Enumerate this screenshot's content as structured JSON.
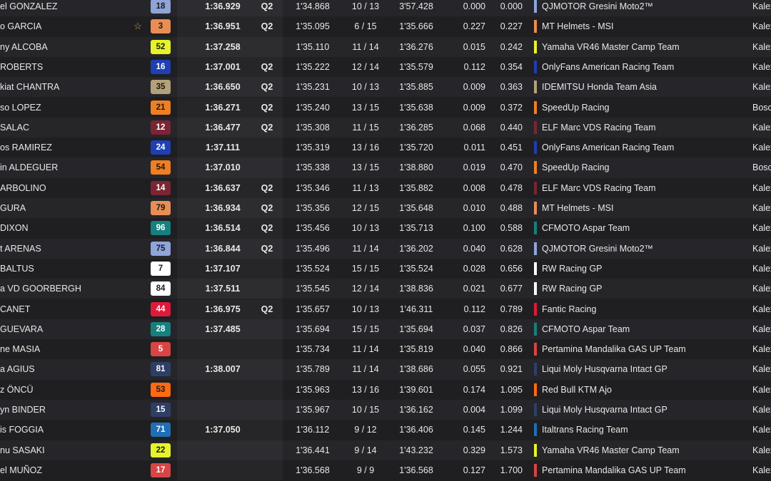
{
  "riders": [
    {
      "name": "el GONZALEZ",
      "fav": false,
      "number": "18",
      "num_bg": "#8fa4d9",
      "num_fg": "#1a1a1a",
      "best": "1:36.929",
      "q": "Q2",
      "lap": "1'34.868",
      "laps": "10 / 13",
      "ref": "3'57.428",
      "gap1": "0.000",
      "gap2": "0.000",
      "team": "QJMOTOR Gresini Moto2™",
      "team_color": "#8fa4d9",
      "manufacturer": "Kalex"
    },
    {
      "name": "o GARCIA",
      "fav": true,
      "number": "3",
      "num_bg": "#e98d55",
      "num_fg": "#1a1a1a",
      "best": "1:36.951",
      "q": "Q2",
      "lap": "1'35.095",
      "laps": "6 / 15",
      "ref": "1'35.666",
      "gap1": "0.227",
      "gap2": "0.227",
      "team": "MT Helmets - MSI",
      "team_color": "#e98d55",
      "manufacturer": "Kalex"
    },
    {
      "name": "ny ALCOBA",
      "fav": false,
      "number": "52",
      "num_bg": "#e6f32a",
      "num_fg": "#1a1a1a",
      "best": "1:37.258",
      "q": "",
      "lap": "1'35.110",
      "laps": "11 / 14",
      "ref": "1'36.276",
      "gap1": "0.015",
      "gap2": "0.242",
      "team": "Yamaha VR46 Master Camp Team",
      "team_color": "#e6f32a",
      "manufacturer": "Kalex"
    },
    {
      "name": "ROBERTS",
      "fav": false,
      "number": "16",
      "num_bg": "#1f3fb3",
      "num_fg": "#ffffff",
      "best": "1:37.001",
      "q": "Q2",
      "lap": "1'35.222",
      "laps": "12 / 14",
      "ref": "1'35.579",
      "gap1": "0.112",
      "gap2": "0.354",
      "team": "OnlyFans American Racing Team",
      "team_color": "#1f3fb3",
      "manufacturer": "Kalex"
    },
    {
      "name": "kiat CHANTRA",
      "fav": false,
      "number": "35",
      "num_bg": "#b3a17a",
      "num_fg": "#1a1a1a",
      "best": "1:36.650",
      "q": "Q2",
      "lap": "1'35.231",
      "laps": "10 / 13",
      "ref": "1'35.885",
      "gap1": "0.009",
      "gap2": "0.363",
      "team": "IDEMITSU Honda Team Asia",
      "team_color": "#b3a17a",
      "manufacturer": "Kalex"
    },
    {
      "name": "so LOPEZ",
      "fav": false,
      "number": "21",
      "num_bg": "#ef7f22",
      "num_fg": "#1a1a1a",
      "best": "1:36.271",
      "q": "Q2",
      "lap": "1'35.240",
      "laps": "13 / 15",
      "ref": "1'35.638",
      "gap1": "0.009",
      "gap2": "0.372",
      "team": "SpeedUp Racing",
      "team_color": "#ef7f22",
      "manufacturer": "Bosc"
    },
    {
      "name": "SALAC",
      "fav": false,
      "number": "12",
      "num_bg": "#7b2534",
      "num_fg": "#ffffff",
      "best": "1:36.477",
      "q": "Q2",
      "lap": "1'35.308",
      "laps": "11 / 15",
      "ref": "1'36.285",
      "gap1": "0.068",
      "gap2": "0.440",
      "team": "ELF Marc VDS Racing Team",
      "team_color": "#7b2534",
      "manufacturer": "Kalex"
    },
    {
      "name": "os RAMIREZ",
      "fav": false,
      "number": "24",
      "num_bg": "#1f3fb3",
      "num_fg": "#ffffff",
      "best": "1:37.111",
      "q": "",
      "lap": "1'35.319",
      "laps": "13 / 16",
      "ref": "1'35.720",
      "gap1": "0.011",
      "gap2": "0.451",
      "team": "OnlyFans American Racing Team",
      "team_color": "#1f3fb3",
      "manufacturer": "Kalex"
    },
    {
      "name": "in ALDEGUER",
      "fav": false,
      "number": "54",
      "num_bg": "#ef7f22",
      "num_fg": "#1a1a1a",
      "best": "1:37.010",
      "q": "",
      "lap": "1'35.338",
      "laps": "13 / 15",
      "ref": "1'38.880",
      "gap1": "0.019",
      "gap2": "0.470",
      "team": "SpeedUp Racing",
      "team_color": "#ef7f22",
      "manufacturer": "Bosc"
    },
    {
      "name": "ARBOLINO",
      "fav": false,
      "number": "14",
      "num_bg": "#7b2534",
      "num_fg": "#ffffff",
      "best": "1:36.637",
      "q": "Q2",
      "lap": "1'35.346",
      "laps": "11 / 13",
      "ref": "1'35.882",
      "gap1": "0.008",
      "gap2": "0.478",
      "team": "ELF Marc VDS Racing Team",
      "team_color": "#7b2534",
      "manufacturer": "Kalex"
    },
    {
      "name": "GURA",
      "fav": false,
      "number": "79",
      "num_bg": "#e98d55",
      "num_fg": "#1a1a1a",
      "best": "1:36.934",
      "q": "Q2",
      "lap": "1'35.356",
      "laps": "12 / 15",
      "ref": "1'35.648",
      "gap1": "0.010",
      "gap2": "0.488",
      "team": "MT Helmets - MSI",
      "team_color": "#e98d55",
      "manufacturer": "Kalex"
    },
    {
      "name": "DIXON",
      "fav": false,
      "number": "96",
      "num_bg": "#16807f",
      "num_fg": "#ffffff",
      "best": "1:36.514",
      "q": "Q2",
      "lap": "1'35.456",
      "laps": "10 / 13",
      "ref": "1'35.713",
      "gap1": "0.100",
      "gap2": "0.588",
      "team": "CFMOTO Aspar Team",
      "team_color": "#16807f",
      "manufacturer": "Kalex"
    },
    {
      "name": "t ARENAS",
      "fav": false,
      "number": "75",
      "num_bg": "#8fa4d9",
      "num_fg": "#1a1a1a",
      "best": "1:36.844",
      "q": "Q2",
      "lap": "1'35.496",
      "laps": "11 / 14",
      "ref": "1'36.202",
      "gap1": "0.040",
      "gap2": "0.628",
      "team": "QJMOTOR Gresini Moto2™",
      "team_color": "#8fa4d9",
      "manufacturer": "Kalex"
    },
    {
      "name": "BALTUS",
      "fav": false,
      "number": "7",
      "num_bg": "#ffffff",
      "num_fg": "#1a1a1a",
      "best": "1:37.107",
      "q": "",
      "lap": "1'35.524",
      "laps": "15 / 15",
      "ref": "1'35.524",
      "gap1": "0.028",
      "gap2": "0.656",
      "team": "RW Racing GP",
      "team_color": "#ffffff",
      "manufacturer": "Kalex"
    },
    {
      "name": "a VD GOORBERGH",
      "fav": false,
      "number": "84",
      "num_bg": "#ffffff",
      "num_fg": "#1a1a1a",
      "best": "1:37.511",
      "q": "",
      "lap": "1'35.545",
      "laps": "12 / 14",
      "ref": "1'38.836",
      "gap1": "0.021",
      "gap2": "0.677",
      "team": "RW Racing GP",
      "team_color": "#ffffff",
      "manufacturer": "Kalex"
    },
    {
      "name": "CANET",
      "fav": false,
      "number": "44",
      "num_bg": "#e0193a",
      "num_fg": "#ffffff",
      "best": "1:36.975",
      "q": "Q2",
      "lap": "1'35.657",
      "laps": "10 / 13",
      "ref": "1'46.311",
      "gap1": "0.112",
      "gap2": "0.789",
      "team": "Fantic Racing",
      "team_color": "#e0193a",
      "manufacturer": "Kalex"
    },
    {
      "name": "GUEVARA",
      "fav": false,
      "number": "28",
      "num_bg": "#16807f",
      "num_fg": "#ffffff",
      "best": "1:37.485",
      "q": "",
      "lap": "1'35.694",
      "laps": "15 / 15",
      "ref": "1'35.694",
      "gap1": "0.037",
      "gap2": "0.826",
      "team": "CFMOTO Aspar Team",
      "team_color": "#16807f",
      "manufacturer": "Kalex"
    },
    {
      "name": "ne MASIA",
      "fav": false,
      "number": "5",
      "num_bg": "#d94444",
      "num_fg": "#ffffff",
      "best": "",
      "q": "",
      "lap": "1'35.734",
      "laps": "11 / 14",
      "ref": "1'35.819",
      "gap1": "0.040",
      "gap2": "0.866",
      "team": "Pertamina Mandalika GAS UP Team",
      "team_color": "#d94444",
      "manufacturer": "Kalex"
    },
    {
      "name": "a AGIUS",
      "fav": false,
      "number": "81",
      "num_bg": "#2e3f66",
      "num_fg": "#ffffff",
      "best": "1:38.007",
      "q": "",
      "lap": "1'35.789",
      "laps": "11 / 14",
      "ref": "1'38.686",
      "gap1": "0.055",
      "gap2": "0.921",
      "team": "Liqui Moly Husqvarna Intact GP",
      "team_color": "#2e3f66",
      "manufacturer": "Kalex"
    },
    {
      "name": "z ÖNCÜ",
      "fav": false,
      "number": "53",
      "num_bg": "#ff6a13",
      "num_fg": "#1a1a1a",
      "best": "",
      "q": "",
      "lap": "1'35.963",
      "laps": "13 / 16",
      "ref": "1'39.601",
      "gap1": "0.174",
      "gap2": "1.095",
      "team": "Red Bull KTM Ajo",
      "team_color": "#ff6a13",
      "manufacturer": "Kalex"
    },
    {
      "name": "yn BINDER",
      "fav": false,
      "number": "15",
      "num_bg": "#2e3f66",
      "num_fg": "#ffffff",
      "best": "",
      "q": "",
      "lap": "1'35.967",
      "laps": "10 / 15",
      "ref": "1'36.162",
      "gap1": "0.004",
      "gap2": "1.099",
      "team": "Liqui Moly Husqvarna Intact GP",
      "team_color": "#2e3f66",
      "manufacturer": "Kalex"
    },
    {
      "name": "is FOGGIA",
      "fav": false,
      "number": "71",
      "num_bg": "#1e6fb8",
      "num_fg": "#ffffff",
      "best": "1:37.050",
      "q": "",
      "lap": "1'36.112",
      "laps": "9 / 12",
      "ref": "1'36.406",
      "gap1": "0.145",
      "gap2": "1.244",
      "team": "Italtrans Racing Team",
      "team_color": "#1e6fb8",
      "manufacturer": "Kalex"
    },
    {
      "name": "nu SASAKI",
      "fav": false,
      "number": "22",
      "num_bg": "#e6f32a",
      "num_fg": "#1a1a1a",
      "best": "",
      "q": "",
      "lap": "1'36.441",
      "laps": "9 / 14",
      "ref": "1'43.232",
      "gap1": "0.329",
      "gap2": "1.573",
      "team": "Yamaha VR46 Master Camp Team",
      "team_color": "#e6f32a",
      "manufacturer": "Kalex"
    },
    {
      "name": "el MUÑOZ",
      "fav": false,
      "number": "17",
      "num_bg": "#d94444",
      "num_fg": "#ffffff",
      "best": "",
      "q": "",
      "lap": "1'36.568",
      "laps": "9 / 9",
      "ref": "1'36.568",
      "gap1": "0.127",
      "gap2": "1.700",
      "team": "Pertamina Mandalika GAS UP Team",
      "team_color": "#d94444",
      "manufacturer": "Kalex"
    }
  ],
  "icons": {
    "favorite": "star-outline-icon"
  }
}
